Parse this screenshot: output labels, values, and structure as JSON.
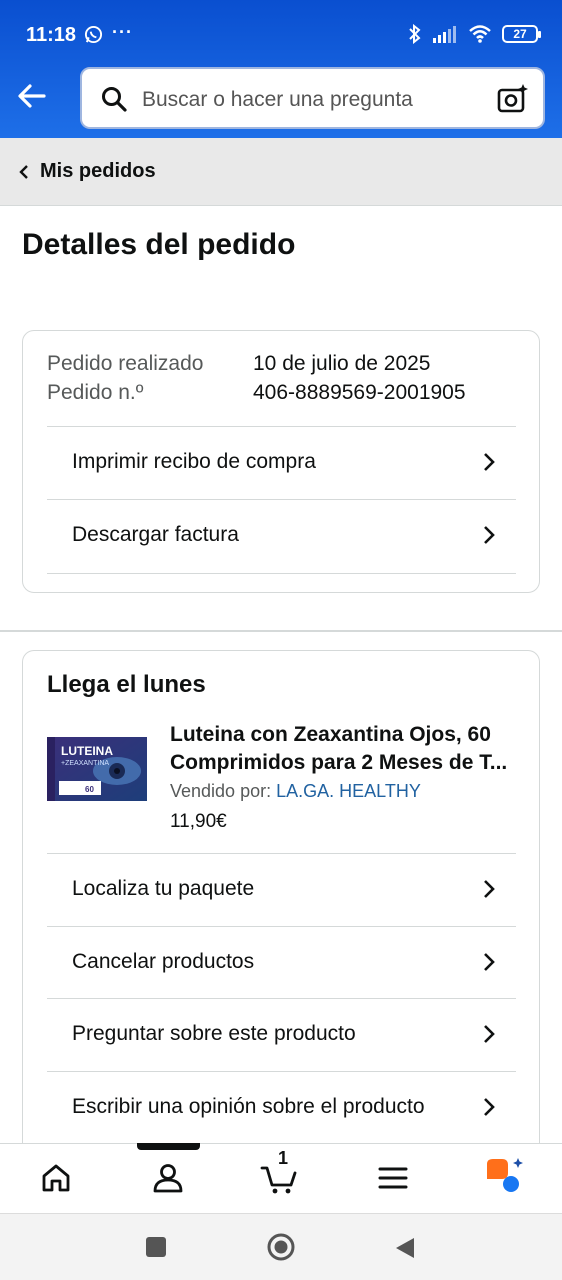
{
  "status_bar": {
    "time": "11:18",
    "extra": "···",
    "battery": "27"
  },
  "search": {
    "placeholder": "Buscar o hacer una pregunta"
  },
  "breadcrumb": {
    "label": "Mis pedidos"
  },
  "page": {
    "title": "Detalles del pedido"
  },
  "order_info": {
    "placed_label": "Pedido realizado",
    "placed_value": "10 de julio de 2025",
    "number_label": "Pedido n.º",
    "number_value": "406-8889569-2001905",
    "actions": [
      {
        "label": "Imprimir recibo de compra"
      },
      {
        "label": "Descargar factura"
      }
    ]
  },
  "shipment": {
    "heading": "Llega el lunes",
    "product": {
      "name": "Luteina con Zeaxantina Ojos, 60 Comprimidos para 2 Meses de T...",
      "seller_prefix": "Vendido por:",
      "seller_name": "LA.GA. HEALTHY",
      "price": "11,90€",
      "thumb_text_1": "LUTEINA",
      "thumb_text_2": "+ZEAXANTINA",
      "thumb_count": "60"
    },
    "actions": [
      {
        "label": "Localiza tu paquete"
      },
      {
        "label": "Cancelar productos"
      },
      {
        "label": "Preguntar sobre este producto"
      },
      {
        "label": "Escribir una opinión sobre el producto"
      }
    ]
  },
  "bottom_nav": {
    "items": [
      "home-icon",
      "account-icon",
      "cart-icon",
      "menu-icon",
      "rufus-icon"
    ],
    "cart_count": "1",
    "active": "account"
  },
  "colors": {
    "header": "#1e6fe8",
    "link": "#2162a1",
    "rufus_orange": "#ff6f1a",
    "rufus_blue": "#1877f2"
  }
}
